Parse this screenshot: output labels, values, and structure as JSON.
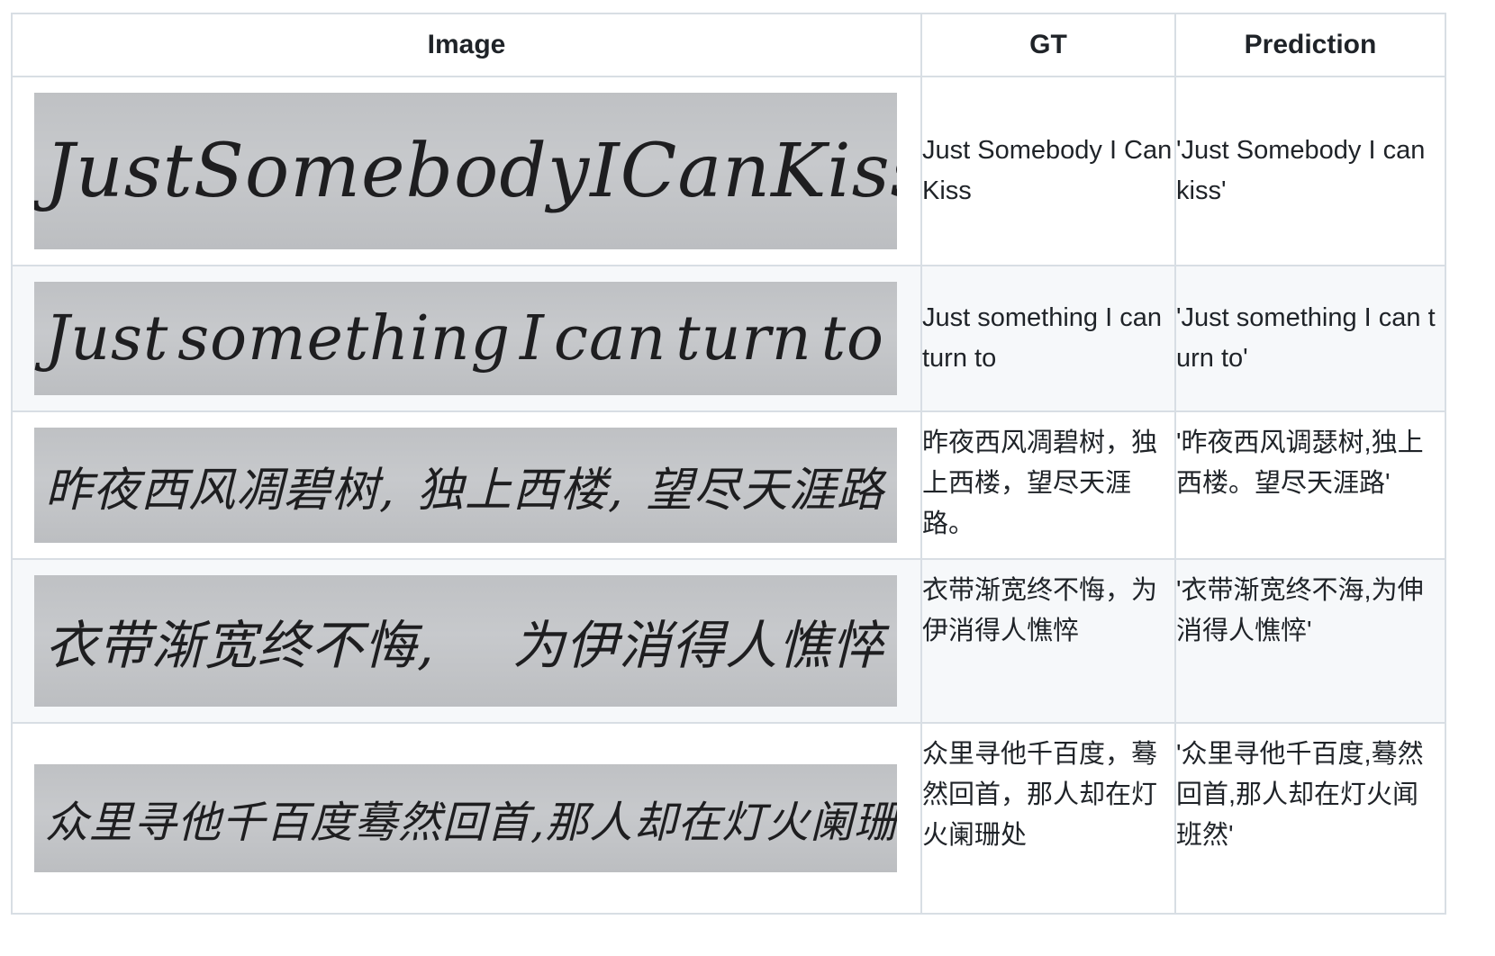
{
  "headers": {
    "image": "Image",
    "gt": "GT",
    "prediction": "Prediction"
  },
  "rows": [
    {
      "handwriting": [
        "Just",
        "Somebody",
        "I",
        "Can",
        "Kiss"
      ],
      "gt": "Just Somebody I Can Kiss",
      "prediction": "'Just Somebody I can kiss'"
    },
    {
      "handwriting": [
        "Just",
        "something",
        "I",
        "can",
        "turn",
        "to"
      ],
      "gt": "Just something I can turn to",
      "prediction": "'Just something I can turn to'"
    },
    {
      "handwriting": [
        "昨夜西风凋碧树,",
        "独上西楼,",
        "望尽天涯路"
      ],
      "gt": "昨夜西风凋碧树，独上西楼，望尽天涯路。",
      "prediction": "'昨夜西风调瑟树,独上西楼。望尽天涯路'"
    },
    {
      "handwriting": [
        "衣带渐宽终不悔,",
        "为伊消得人憔悴"
      ],
      "gt": "衣带渐宽终不悔，为伊消得人憔悴",
      "prediction": "'衣带渐宽终不海,为伸消得人憔悴'"
    },
    {
      "handwriting": [
        "众里寻他千百度",
        "蓦然回首,",
        "那人却在灯火阑珊处"
      ],
      "gt": "众里寻他千百度，蓦然回首，那人却在灯火阑珊处",
      "prediction": "'众里寻他千百度,蓦然回首,那人却在灯火闻班然'"
    }
  ]
}
